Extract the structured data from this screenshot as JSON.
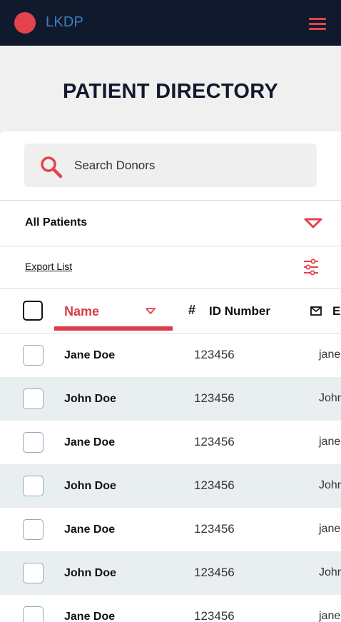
{
  "app": {
    "brand": "LKDP",
    "colors": {
      "navbar": "#111a2c",
      "accent": "#e3434d",
      "brand_text": "#3b80c4",
      "stripe": "#e9eef0"
    }
  },
  "header": {
    "menu_icon": "hamburger-menu-icon",
    "logo_icon": "red-dot-logo"
  },
  "page": {
    "title": "PATIENT DIRECTORY"
  },
  "search": {
    "placeholder": "Search Donors",
    "icon": "search-icon"
  },
  "filter": {
    "selected": "All Patients",
    "icon": "chevron-down-icon"
  },
  "toolbar": {
    "export_label": "Export List",
    "settings_icon": "sliders-icon"
  },
  "table": {
    "columns": {
      "name": "Name",
      "id_symbol": "#",
      "id": "ID Number",
      "email_cut": "E"
    },
    "rows": [
      {
        "name": "Jane Doe",
        "id": "123456",
        "email": "jane"
      },
      {
        "name": "John Doe",
        "id": "123456",
        "email": "John"
      },
      {
        "name": "Jane Doe",
        "id": "123456",
        "email": "jane"
      },
      {
        "name": "John Doe",
        "id": "123456",
        "email": "John"
      },
      {
        "name": "Jane Doe",
        "id": "123456",
        "email": "jane"
      },
      {
        "name": "John Doe",
        "id": "123456",
        "email": "John"
      },
      {
        "name": "Jane Doe",
        "id": "123456",
        "email": "jane"
      }
    ]
  }
}
